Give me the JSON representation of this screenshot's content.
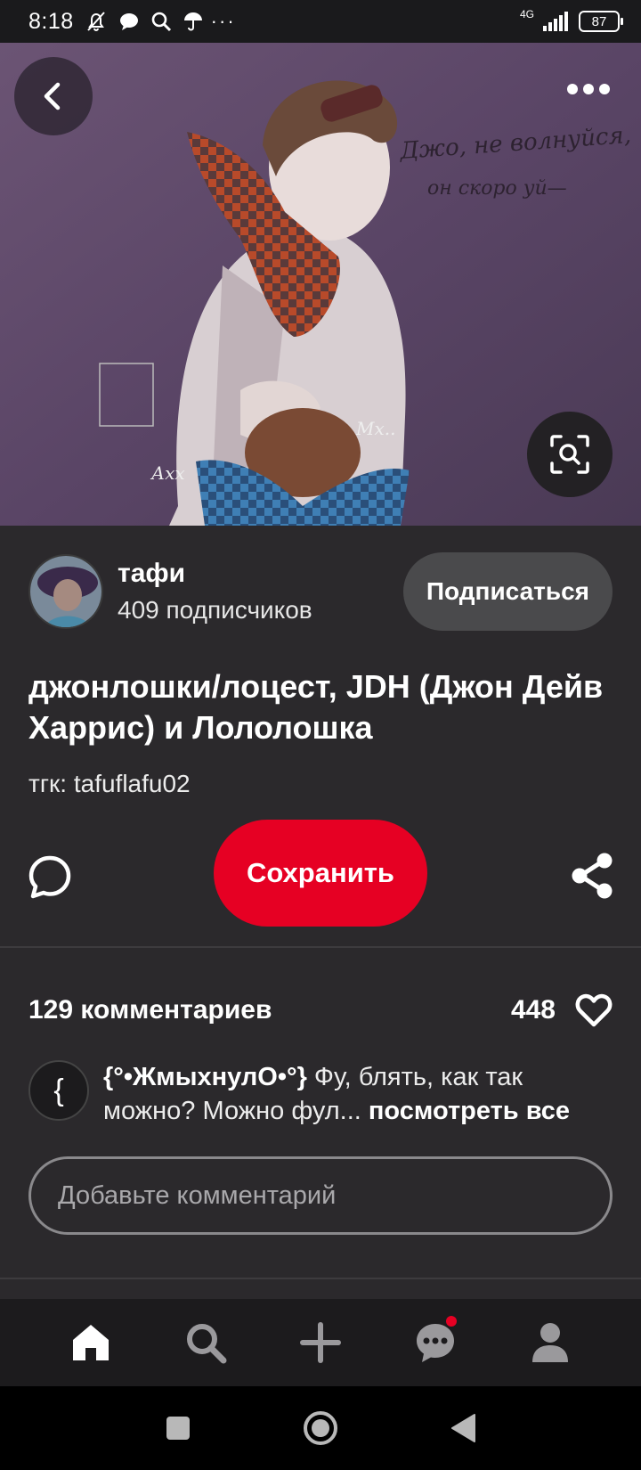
{
  "status_bar": {
    "time": "8:18",
    "network": "4G",
    "battery": "87",
    "overflow": "···"
  },
  "hero": {
    "image_description_icon": "illustration",
    "back_icon": "chevron-left-icon",
    "more_icon": "more-horizontal-icon",
    "lens_icon": "visual-search-icon"
  },
  "author": {
    "name": "тафи",
    "followers": "409 подписчиков",
    "follow_label": "Подписаться"
  },
  "pin": {
    "title": "джонлошки/лоцест, JDH (Джон Дейв Харрис) и Лололошка",
    "description": "тгк: tafuflafu02"
  },
  "actions": {
    "save_label": "Сохранить",
    "comment_icon": "comment-bubble-icon",
    "share_icon": "share-icon"
  },
  "comments": {
    "count_label": "129 комментариев",
    "likes": "448",
    "preview": {
      "avatar_glyph": "{",
      "author": "{°•ЖмыхнулО•°}",
      "text": " Фу, блять, как так можно? Можно фул... ",
      "see_all": "посмотреть все"
    },
    "input_placeholder": "Добавьте комментарий"
  },
  "bottom_nav": {
    "items": [
      "home-icon",
      "search-icon",
      "create-icon",
      "messages-icon",
      "profile-icon"
    ],
    "active": "home-icon"
  },
  "colors": {
    "accent": "#e60023",
    "background": "#2b292c",
    "nav_background": "#1c1b1d"
  }
}
